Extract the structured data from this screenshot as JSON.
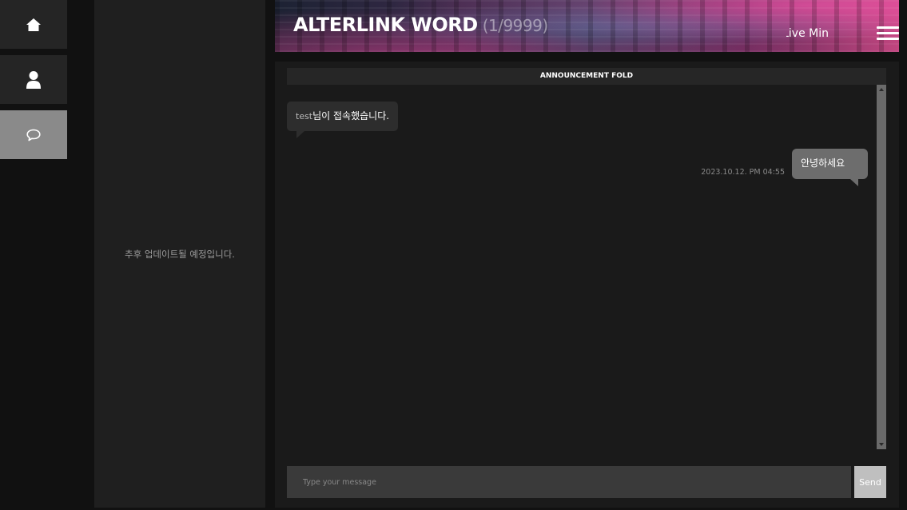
{
  "nav": {
    "items": [
      {
        "icon": "home-icon"
      },
      {
        "icon": "user-icon"
      },
      {
        "icon": "chat-icon",
        "active": true
      }
    ]
  },
  "side_panel": {
    "message": "추후 업데이트될 예정입니다."
  },
  "header": {
    "title": "ALTERLINK WORD",
    "count": "(1/9999)",
    "marquee": "Greeting  Live Min"
  },
  "chat": {
    "announcement_label": "ANNOUNCEMENT FOLD",
    "system_message": {
      "username": "test",
      "text": "님이 접속했습니다."
    },
    "outgoing": {
      "text": "안녕하세요",
      "timestamp": "2023.10.12. PM 04:55"
    },
    "input_placeholder": "Type your message",
    "send_label": "Send"
  },
  "colors": {
    "background": "#111111",
    "panel": "#1f1f1f",
    "chat_bg": "#1a1a1a",
    "active_nav": "#8a8a8a",
    "my_bubble": "#6d6d6d"
  }
}
